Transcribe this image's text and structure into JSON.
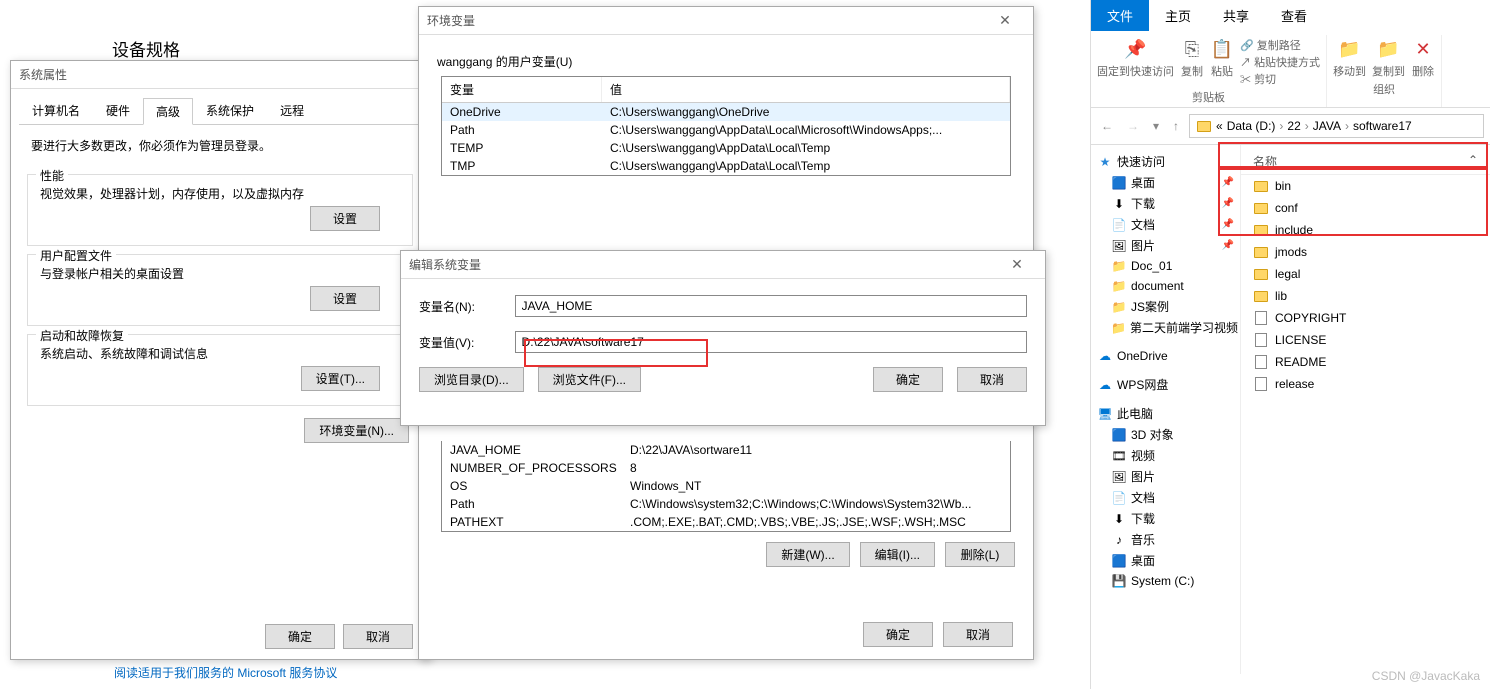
{
  "section_heading": "设备规格",
  "sysprops": {
    "title": "系统属性",
    "tabs": [
      "计算机名",
      "硬件",
      "高级",
      "系统保护",
      "远程"
    ],
    "active_tab": 2,
    "admin_note": "要进行大多数更改，你必须作为管理员登录。",
    "perf": {
      "title": "性能",
      "desc": "视觉效果，处理器计划，内存使用，以及虚拟内存",
      "btn": "设置"
    },
    "profile": {
      "title": "用户配置文件",
      "desc": "与登录帐户相关的桌面设置",
      "btn": "设置"
    },
    "startup": {
      "title": "启动和故障恢复",
      "desc": "系统启动、系统故障和调试信息",
      "btn": "设置(T)..."
    },
    "envvar_btn": "环境变量(N)...",
    "ok": "确定",
    "cancel": "取消"
  },
  "envdialog": {
    "title": "环境变量",
    "user_label": "wanggang 的用户变量(U)",
    "col_var": "变量",
    "col_val": "值",
    "user_vars": [
      {
        "name": "OneDrive",
        "value": "C:\\Users\\wanggang\\OneDrive"
      },
      {
        "name": "Path",
        "value": "C:\\Users\\wanggang\\AppData\\Local\\Microsoft\\WindowsApps;..."
      },
      {
        "name": "TEMP",
        "value": "C:\\Users\\wanggang\\AppData\\Local\\Temp"
      },
      {
        "name": "TMP",
        "value": "C:\\Users\\wanggang\\AppData\\Local\\Temp"
      }
    ],
    "sys_vars": [
      {
        "name": "JAVA_HOME",
        "value": "D:\\22\\JAVA\\sortware11"
      },
      {
        "name": "NUMBER_OF_PROCESSORS",
        "value": "8"
      },
      {
        "name": "OS",
        "value": "Windows_NT"
      },
      {
        "name": "Path",
        "value": "C:\\Windows\\system32;C:\\Windows;C:\\Windows\\System32\\Wb..."
      },
      {
        "name": "PATHEXT",
        "value": ".COM;.EXE;.BAT;.CMD;.VBS;.VBE;.JS;.JSE;.WSF;.WSH;.MSC"
      }
    ],
    "new_btn": "新建(W)...",
    "edit_btn": "编辑(I)...",
    "del_btn": "删除(L)",
    "ok": "确定",
    "cancel": "取消"
  },
  "editdialog": {
    "title": "编辑系统变量",
    "name_label": "变量名(N):",
    "value_label": "变量值(V):",
    "name_value": "JAVA_HOME",
    "value_value": "D:\\22\\JAVA\\software17",
    "browse_dir": "浏览目录(D)...",
    "browse_file": "浏览文件(F)...",
    "ok": "确定",
    "cancel": "取消"
  },
  "footer_link": "阅读适用于我们服务的 Microsoft 服务协议",
  "explorer": {
    "tabs": [
      "文件",
      "主页",
      "共享",
      "查看"
    ],
    "active_tab": 1,
    "ribbon": {
      "pin": "固定到快速访问",
      "copy": "复制",
      "paste": "粘贴",
      "copypath": "复制路径",
      "pasteshortcut": "粘贴快捷方式",
      "cut": "剪切",
      "clipboard": "剪贴板",
      "moveto": "移动到",
      "copyto": "复制到",
      "delete": "删除",
      "organize": "组织"
    },
    "breadcrumb": [
      "Data (D:)",
      "22",
      "JAVA",
      "software17"
    ],
    "tree": {
      "quick": "快速访问",
      "quick_items": [
        "桌面",
        "下载",
        "文档",
        "图片",
        "Doc_01",
        "document",
        "JS案例",
        "第二天前端学习视频"
      ],
      "onedrive": "OneDrive",
      "wps": "WPS网盘",
      "thispc": "此电脑",
      "pc_items": [
        "3D 对象",
        "视频",
        "图片",
        "文档",
        "下载",
        "音乐",
        "桌面",
        "System (C:)"
      ]
    },
    "filelist": {
      "head": "名称",
      "folders": [
        "bin",
        "conf",
        "include",
        "jmods",
        "legal",
        "lib"
      ],
      "files": [
        "COPYRIGHT",
        "LICENSE",
        "README",
        "release"
      ]
    }
  },
  "watermark": "CSDN @JavacKaka"
}
